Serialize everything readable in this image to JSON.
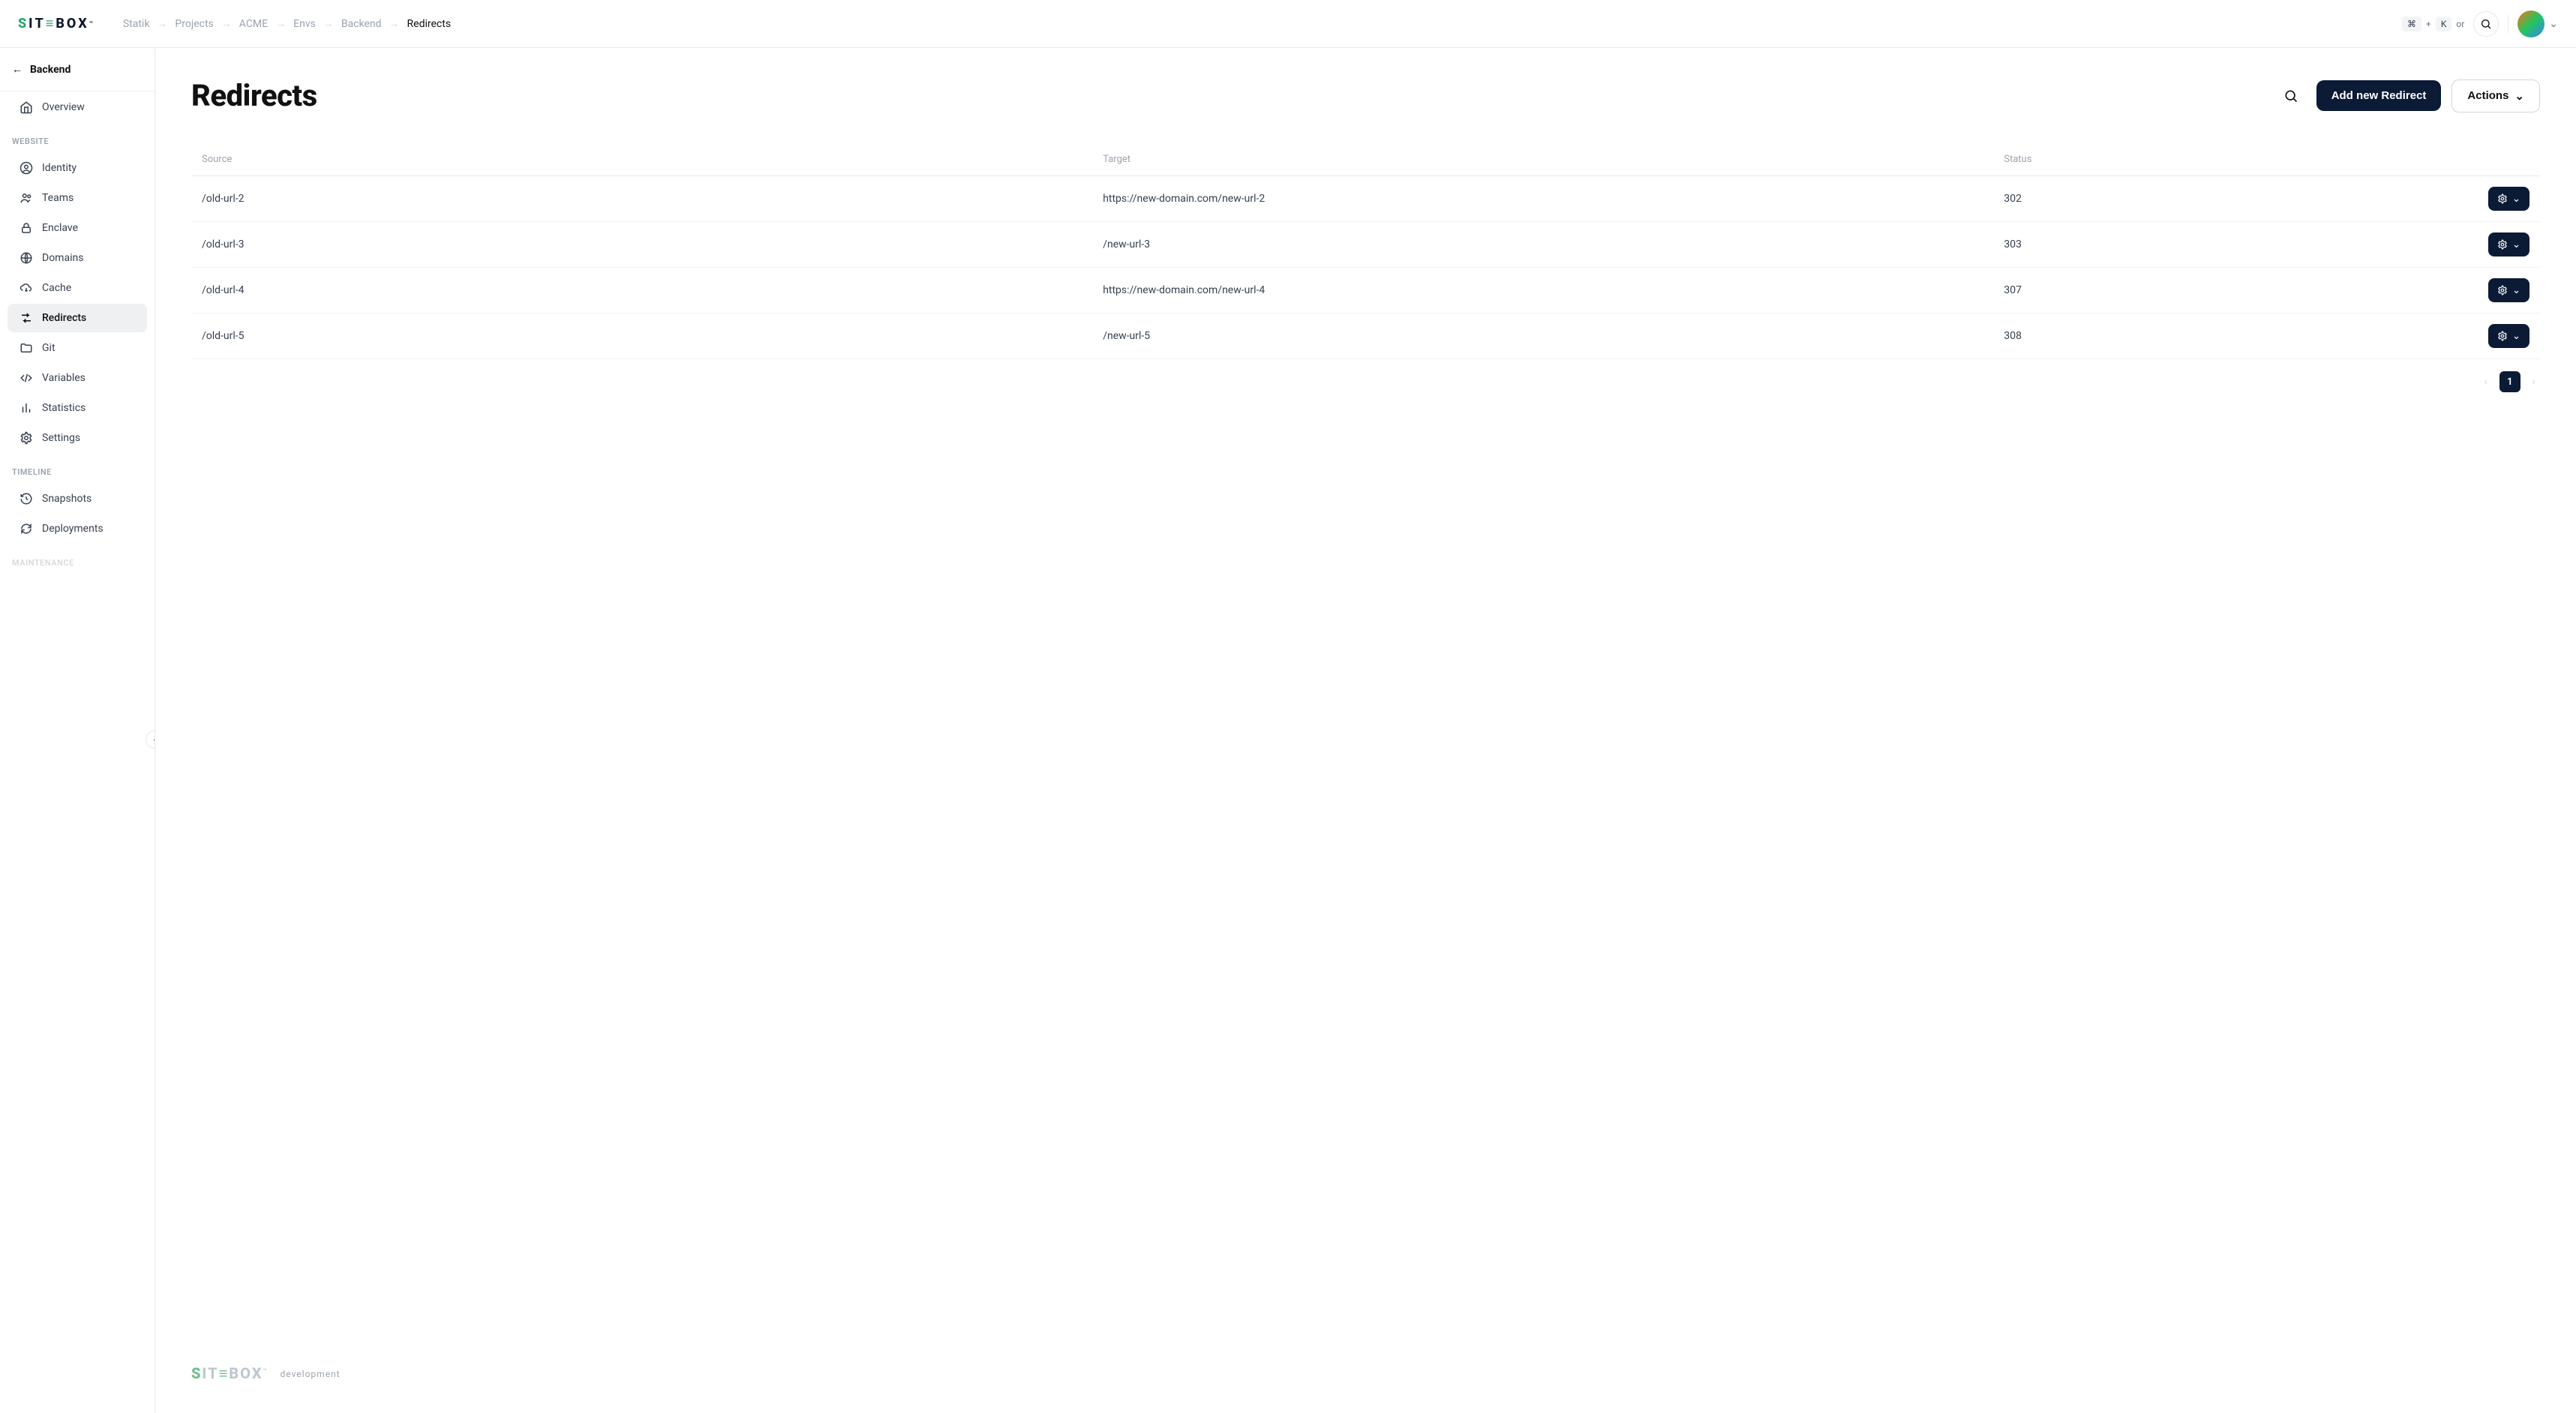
{
  "brand": {
    "name": "SITEBOX",
    "footer_sub": "development"
  },
  "breadcrumb": [
    "Statik",
    "Projects",
    "ACME",
    "Envs",
    "Backend",
    "Redirects"
  ],
  "header": {
    "kbd1": "⌘",
    "plus": "+",
    "kbd2": "K",
    "or": "or"
  },
  "sidebar": {
    "back_label": "Backend",
    "overview": "Overview",
    "section_website": "WEBSITE",
    "items_website": [
      {
        "key": "identity",
        "label": "Identity"
      },
      {
        "key": "teams",
        "label": "Teams"
      },
      {
        "key": "enclave",
        "label": "Enclave"
      },
      {
        "key": "domains",
        "label": "Domains"
      },
      {
        "key": "cache",
        "label": "Cache"
      },
      {
        "key": "redirects",
        "label": "Redirects"
      },
      {
        "key": "git",
        "label": "Git"
      },
      {
        "key": "variables",
        "label": "Variables"
      },
      {
        "key": "statistics",
        "label": "Statistics"
      },
      {
        "key": "settings",
        "label": "Settings"
      }
    ],
    "section_timeline": "TIMELINE",
    "items_timeline": [
      {
        "key": "snapshots",
        "label": "Snapshots"
      },
      {
        "key": "deployments",
        "label": "Deployments"
      }
    ],
    "section_maintenance": "MAINTENANCE"
  },
  "page": {
    "title": "Redirects",
    "add_button": "Add new Redirect",
    "actions_button": "Actions"
  },
  "table": {
    "headers": {
      "source": "Source",
      "target": "Target",
      "status": "Status"
    },
    "rows": [
      {
        "source": "/old-url-2",
        "target": "https://new-domain.com/new-url-2",
        "status": "302"
      },
      {
        "source": "/old-url-3",
        "target": "/new-url-3",
        "status": "303"
      },
      {
        "source": "/old-url-4",
        "target": "https://new-domain.com/new-url-4",
        "status": "307"
      },
      {
        "source": "/old-url-5",
        "target": "/new-url-5",
        "status": "308"
      }
    ]
  },
  "pagination": {
    "current": "1"
  }
}
